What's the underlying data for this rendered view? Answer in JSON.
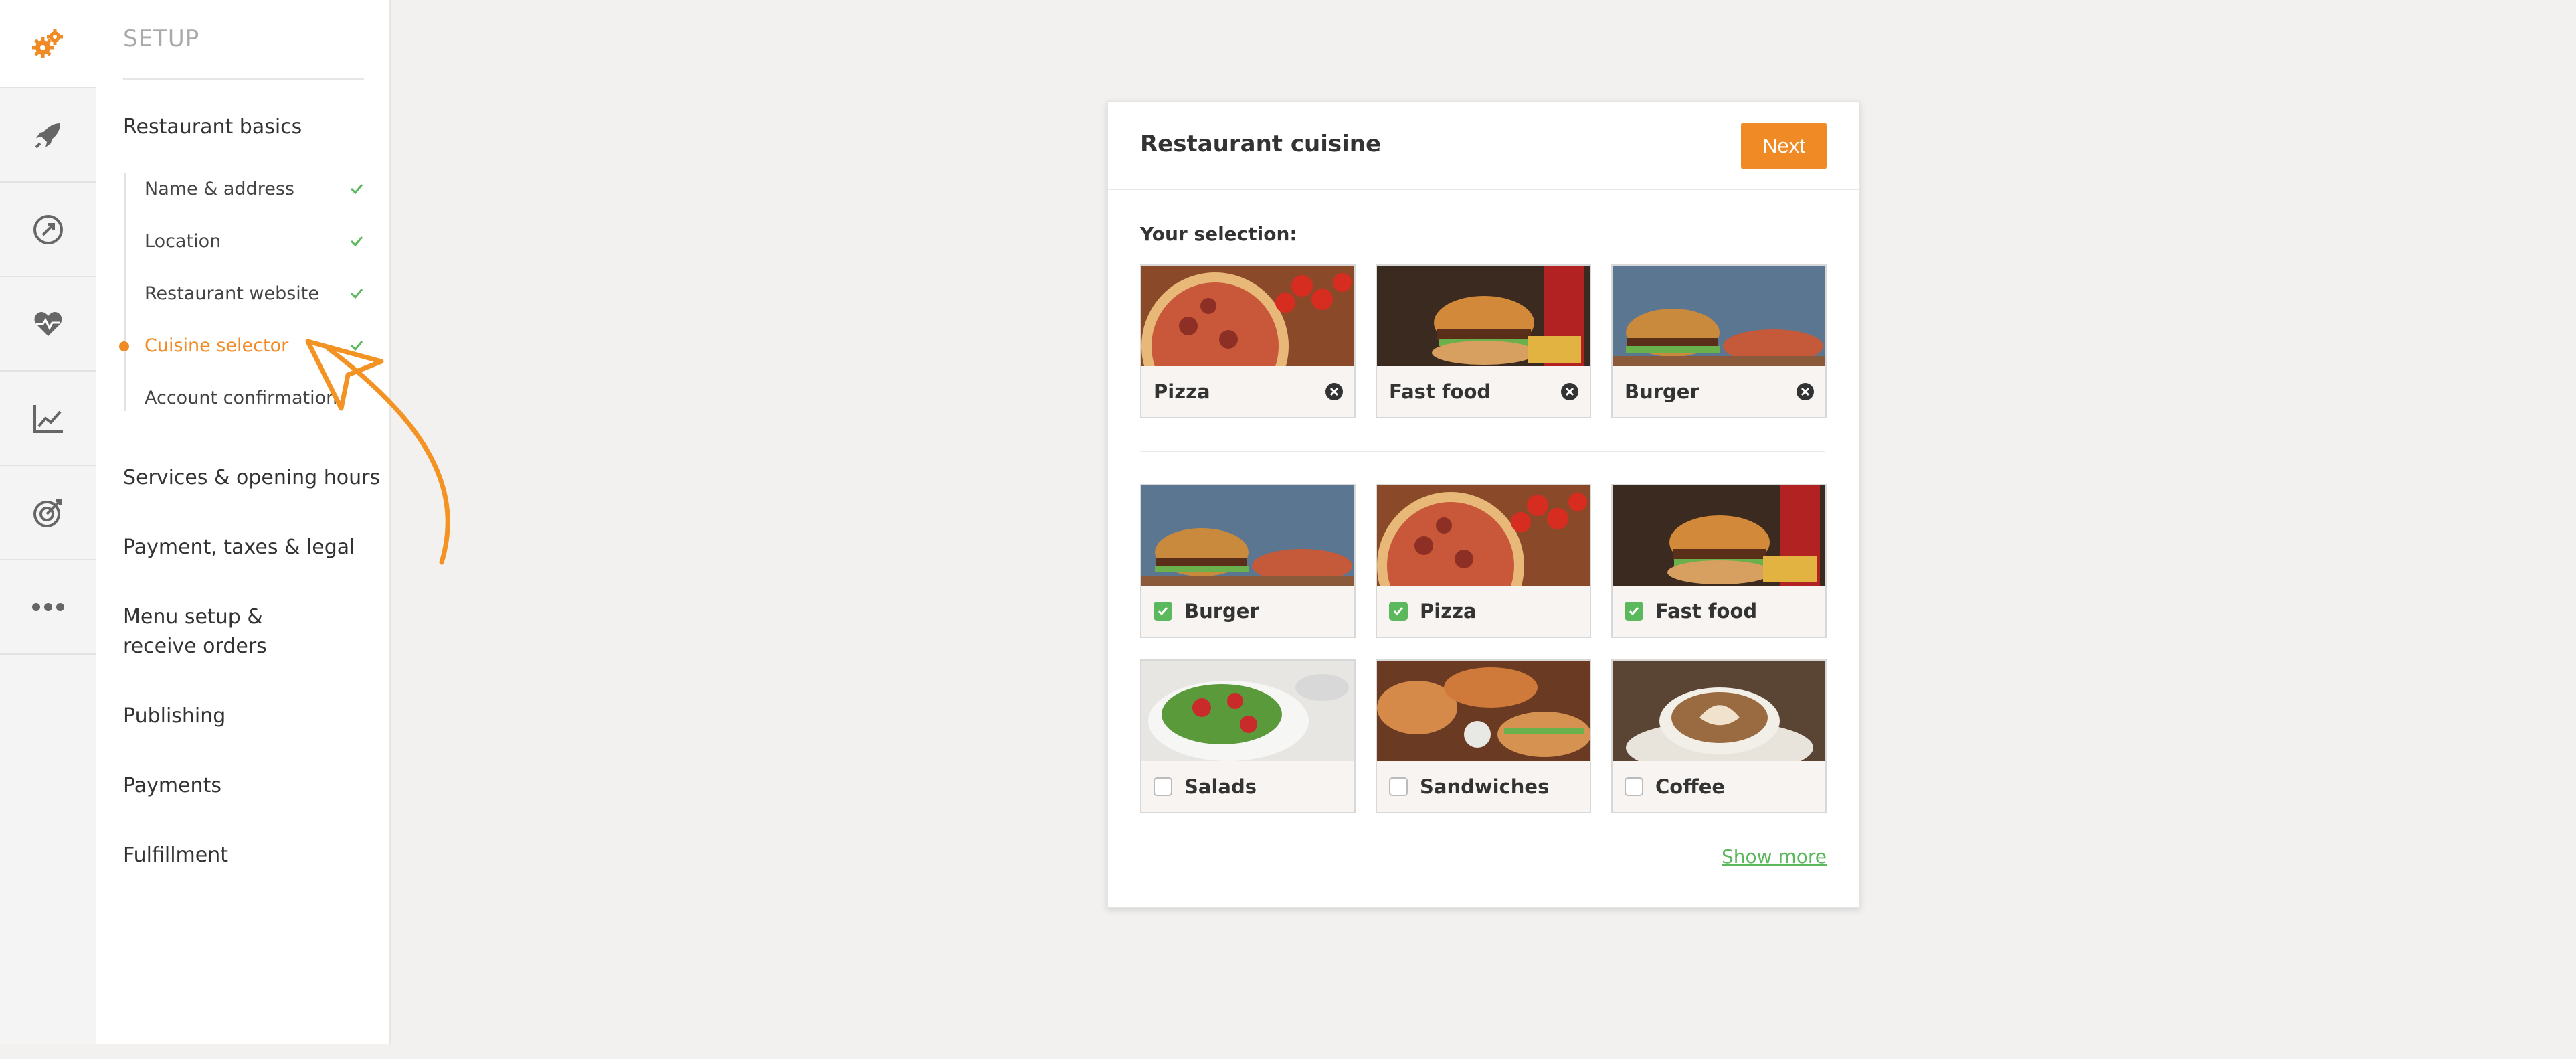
{
  "sidebar": {
    "title": "SETUP",
    "groups": [
      {
        "label": "Restaurant basics"
      },
      {
        "label": "Services & opening hours"
      },
      {
        "label": "Payment, taxes & legal"
      },
      {
        "label": "Menu setup & receive orders"
      },
      {
        "label": "Publishing"
      },
      {
        "label": "Payments"
      },
      {
        "label": "Fulfillment"
      }
    ],
    "steps": [
      {
        "label": "Name & address",
        "done": true
      },
      {
        "label": "Location",
        "done": true
      },
      {
        "label": "Restaurant website",
        "done": true
      },
      {
        "label": "Cuisine selector",
        "done": true,
        "active": true
      },
      {
        "label": "Account confirmation",
        "done": false
      }
    ]
  },
  "rail": {
    "icons": [
      "gears-icon",
      "rocket-icon",
      "speed-icon",
      "heartbeat-icon",
      "chart-line-icon",
      "target-icon",
      "more-icon"
    ]
  },
  "card": {
    "title": "Restaurant cuisine",
    "next_label": "Next",
    "selection_label": "Your selection:",
    "selected": [
      {
        "label": "Pizza"
      },
      {
        "label": "Fast food"
      },
      {
        "label": "Burger"
      }
    ],
    "options": [
      {
        "label": "Burger",
        "checked": true
      },
      {
        "label": "Pizza",
        "checked": true
      },
      {
        "label": "Fast food",
        "checked": true
      },
      {
        "label": "Salads",
        "checked": false
      },
      {
        "label": "Sandwiches",
        "checked": false
      },
      {
        "label": "Coffee",
        "checked": false
      }
    ],
    "show_more": "Show more"
  },
  "colors": {
    "accent": "#f08a24",
    "success": "#5cb85c"
  }
}
